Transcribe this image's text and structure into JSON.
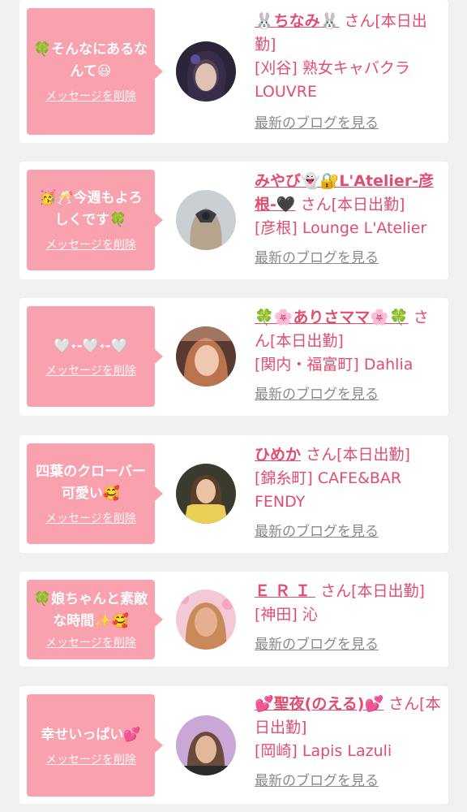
{
  "items": [
    {
      "message": "🍀そんなにあるな\nんて😃",
      "delete_label": "メッセージを削除",
      "name": "🐰ちなみ🐰",
      "suffix": "さん[本日出勤]",
      "location": "[刈谷] 熟女キャバクラLOUVRE",
      "blog_label": "最新のブログを見る",
      "avatar_colors": [
        "#2c2438",
        "#d8b8a8"
      ]
    },
    {
      "message": "🥳🥂今週もよろ\nしくです🍀",
      "delete_label": "メッセージを削除",
      "name": "みやび👻🔐L'Atelier-彦根-🖤",
      "suffix": "さん[本日出勤]",
      "location": "[彦根] Lounge L'Atelier",
      "blog_label": "最新のブログを見る",
      "avatar_colors": [
        "#c9cfd3",
        "#3a3e44"
      ]
    },
    {
      "message": "🤍˖-🤍˖-🤍",
      "delete_label": "メッセージを削除",
      "name": "🍀🌸ありさママ🌸🍀",
      "suffix": "さん[本日出勤]",
      "location": "[関内・福富町] Dahlia",
      "blog_label": "最新のブログを見る",
      "avatar_colors": [
        "#9a5a45",
        "#f0c8b0"
      ]
    },
    {
      "message": "四葉のクローバー\n可愛い🥰",
      "delete_label": "メッセージを削除",
      "name": "ひめか",
      "suffix": "さん[本日出勤]",
      "location": "[錦糸町] CAFE&BAR FENDY",
      "blog_label": "最新のブログを見る",
      "avatar_colors": [
        "#3b3a2f",
        "#e9cf55"
      ]
    },
    {
      "message": "🍀娘ちゃんと素敵\nな時間✨🥰",
      "delete_label": "メッセージを削除",
      "name": "ＥＲＩ",
      "suffix": "さん[本日出勤]",
      "location": "[神田] 沁",
      "blog_label": "最新のブログを見る",
      "avatar_colors": [
        "#f3c9d6",
        "#b07a55"
      ]
    },
    {
      "message": "幸せいっぱい💕",
      "delete_label": "メッセージを削除",
      "name": "💕聖夜(のえる)💕",
      "suffix": "さん[本日出勤]",
      "location": "[岡崎] Lapis Lazuli",
      "blog_label": "最新のブログを見る",
      "avatar_colors": [
        "#c9a8d8",
        "#6a4a3a"
      ]
    }
  ]
}
